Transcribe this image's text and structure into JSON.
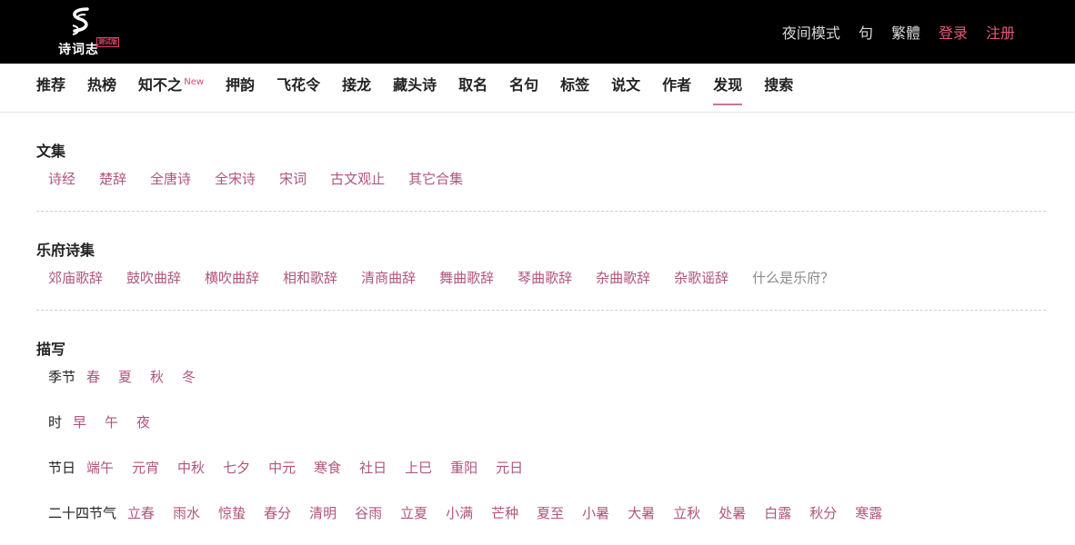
{
  "logo": {
    "text": "诗词志",
    "badge": "测试版"
  },
  "top_links": [
    {
      "label": "夜间模式",
      "accent": false
    },
    {
      "label": "句",
      "accent": false
    },
    {
      "label": "繁體",
      "accent": false
    },
    {
      "label": "登录",
      "accent": true
    },
    {
      "label": "注册",
      "accent": true
    }
  ],
  "nav": [
    {
      "label": "推荐"
    },
    {
      "label": "热榜"
    },
    {
      "label": "知不之",
      "sup": "New"
    },
    {
      "label": "押韵"
    },
    {
      "label": "飞花令"
    },
    {
      "label": "接龙"
    },
    {
      "label": "藏头诗"
    },
    {
      "label": "取名"
    },
    {
      "label": "名句"
    },
    {
      "label": "标签"
    },
    {
      "label": "说文"
    },
    {
      "label": "作者"
    },
    {
      "label": "发现",
      "active": true
    },
    {
      "label": "搜索"
    }
  ],
  "sections": {
    "wenji": {
      "title": "文集",
      "tags": [
        "诗经",
        "楚辞",
        "全唐诗",
        "全宋诗",
        "宋词",
        "古文观止",
        "其它合集"
      ]
    },
    "yuefu": {
      "title": "乐府诗集",
      "tags": [
        "郊庙歌辞",
        "鼓吹曲辞",
        "横吹曲辞",
        "相和歌辞",
        "清商曲辞",
        "舞曲歌辞",
        "琴曲歌辞",
        "杂曲歌辞",
        "杂歌谣辞"
      ],
      "muted_tag": "什么是乐府？"
    },
    "miaoxie": {
      "title": "描写",
      "rows": [
        {
          "label": "季节",
          "tags": [
            "春",
            "夏",
            "秋",
            "冬"
          ]
        },
        {
          "label": "时",
          "tags": [
            "早",
            "午",
            "夜"
          ]
        },
        {
          "label": "节日",
          "tags": [
            "端午",
            "元宵",
            "中秋",
            "七夕",
            "中元",
            "寒食",
            "社日",
            "上巳",
            "重阳",
            "元日"
          ]
        },
        {
          "label": "二十四节气",
          "tags": [
            "立春",
            "雨水",
            "惊蛰",
            "春分",
            "清明",
            "谷雨",
            "立夏",
            "小满",
            "芒种",
            "夏至",
            "小暑",
            "大暑",
            "立秋",
            "处暑",
            "白露",
            "秋分",
            "寒露"
          ]
        }
      ]
    }
  }
}
